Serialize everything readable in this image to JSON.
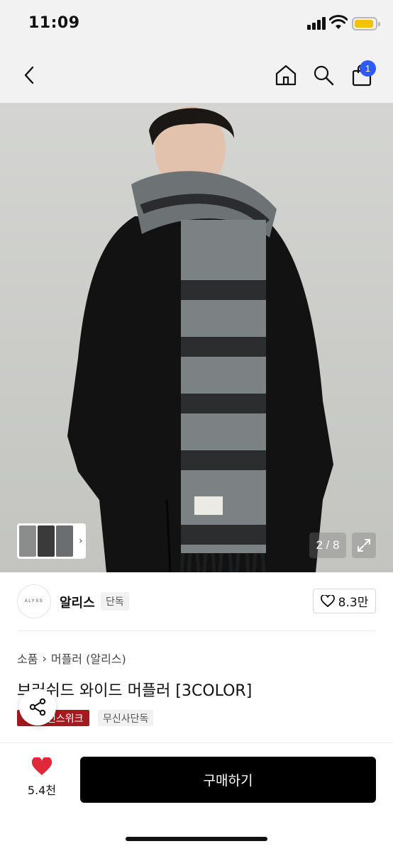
{
  "status_bar": {
    "time": "11:09"
  },
  "nav": {
    "cart_count": "1"
  },
  "gallery": {
    "counter": "2 / 8"
  },
  "brand": {
    "logo_text": "ALYSS",
    "name": "알리스",
    "tag": "단독",
    "likes": "8.3만"
  },
  "product": {
    "breadcrumb": [
      "소품",
      "머플러 (알리스)"
    ],
    "title": "브러쉬드 와이드 머플러 [3COLOR]",
    "tags": [
      "런스위크",
      "무신사단독"
    ]
  },
  "bottom_bar": {
    "heart_count": "5.4천",
    "buy_label": "구매하기"
  },
  "colors": {
    "accent_blue": "#2d5bff",
    "tag_red": "#a41a20",
    "heart_red": "#e0283a",
    "battery_yellow": "#f2c200"
  }
}
